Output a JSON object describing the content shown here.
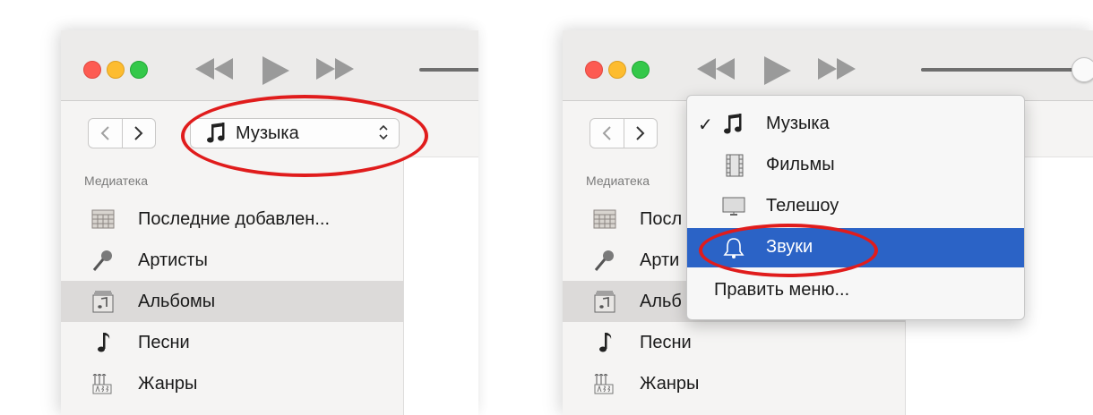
{
  "left_window": {
    "source_selector": {
      "label": "Музыка"
    },
    "library": {
      "section_title": "Медиатека",
      "items": [
        {
          "label": "Последние добавлен...",
          "icon": "recent-grid-icon"
        },
        {
          "label": "Артисты",
          "icon": "microphone-icon"
        },
        {
          "label": "Альбомы",
          "icon": "album-icon",
          "selected": true
        },
        {
          "label": "Песни",
          "icon": "music-note-icon"
        },
        {
          "label": "Жанры",
          "icon": "genres-icon"
        }
      ]
    }
  },
  "right_window": {
    "library": {
      "section_title": "Медиатека",
      "items": [
        {
          "label": "Посл",
          "icon": "recent-grid-icon"
        },
        {
          "label": "Арти",
          "icon": "microphone-icon"
        },
        {
          "label": "Альб",
          "icon": "album-icon",
          "selected": true
        },
        {
          "label": "Песни",
          "icon": "music-note-icon"
        },
        {
          "label": "Жанры",
          "icon": "genres-icon"
        }
      ]
    },
    "dropdown_menu": {
      "items": [
        {
          "label": "Музыка",
          "icon": "music-notes-icon",
          "checked": true
        },
        {
          "label": "Фильмы",
          "icon": "film-icon"
        },
        {
          "label": "Телешоу",
          "icon": "tv-icon"
        },
        {
          "label": "Звуки",
          "icon": "bell-icon",
          "highlighted": true
        },
        {
          "label": "Править меню..."
        }
      ],
      "check_mark": "✓"
    }
  },
  "colors": {
    "annotation_ellipse": "#e01c1c",
    "menu_highlight": "#2b63c6",
    "selected_row": "#dcdad9"
  }
}
